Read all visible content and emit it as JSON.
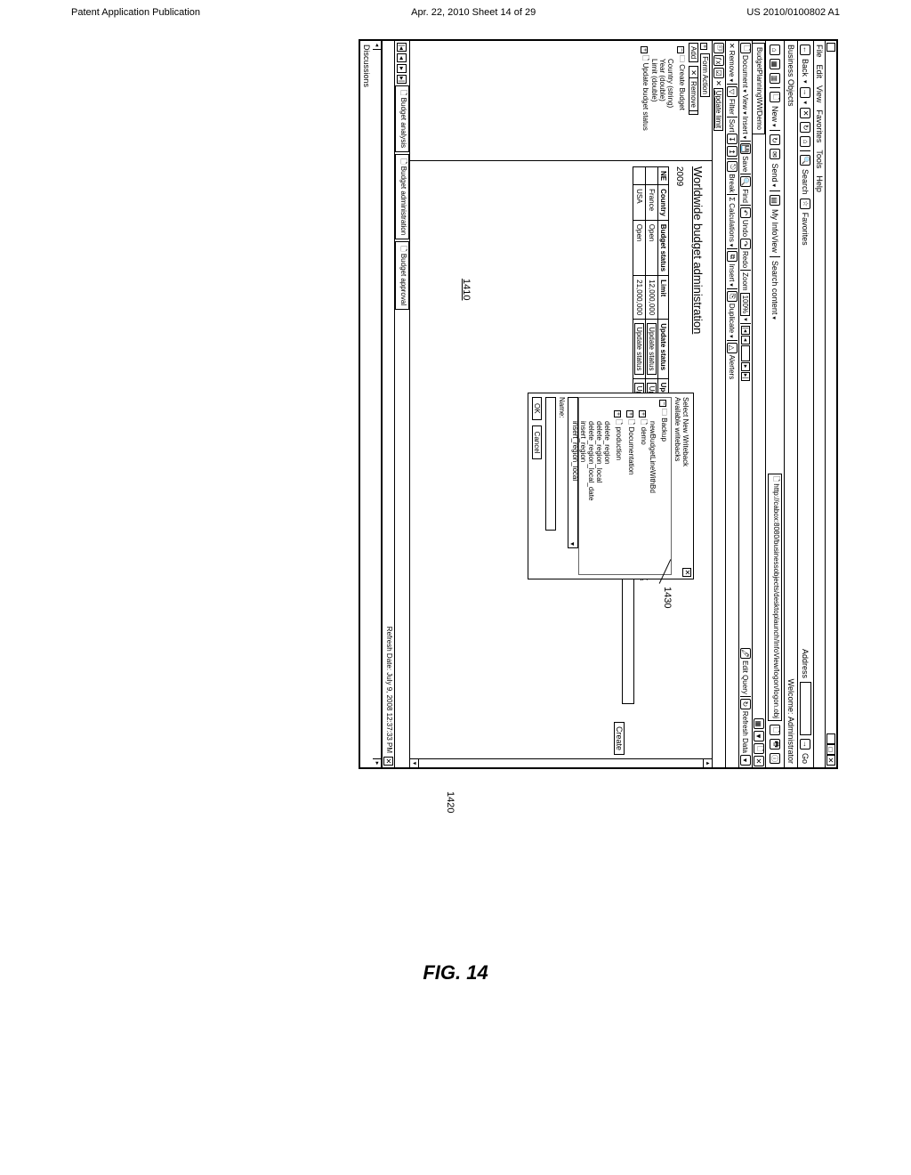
{
  "page_header": {
    "left": "Patent Application Publication",
    "center": "Apr. 22, 2010  Sheet 14 of 29",
    "right": "US 2010/0100802 A1"
  },
  "figure_label": "FIG. 14",
  "callouts": {
    "c1410": "1410",
    "c1420": "1420",
    "c1430": "1430"
  },
  "window": {
    "menus": [
      "File",
      "Edit",
      "View",
      "Favorites",
      "Tools",
      "Help"
    ],
    "back": "Back",
    "search": "Search",
    "favorites": "Favorites",
    "address_label": "Address",
    "go": "Go"
  },
  "portal": {
    "brand": "Business Objects",
    "welcome": "Welcome:",
    "user": "Administrator",
    "new": "New",
    "send": "Send",
    "myinfoview": "My InfoView",
    "search_content": "Search content",
    "url": "http://cabox:8080/businessobjects/desktoplaunch/InfoView/logon/logon.obj"
  },
  "doc": {
    "tab": "BudgetPlanningWWDemo",
    "document": "Document",
    "view": "View",
    "insert": "Insert",
    "save": "Save",
    "find": "Find",
    "undo": "Undo",
    "redo": "Redo",
    "zoom": "Zoom",
    "zoom_value": "100%",
    "edit_query": "Edit Query",
    "refresh_data": "Refresh Data",
    "remove": "Remove",
    "filter": "Filter",
    "sort": "Sort",
    "break": "Break",
    "calculations": "Calculations",
    "insert2": "Insert",
    "duplicate": "Duplicate",
    "alerters": "Alerters",
    "update_limit": "Update limit"
  },
  "form_panel": {
    "title": "Form Action",
    "add": "Add",
    "remove": "Remove",
    "root": "Create Budget",
    "items": [
      "Country (string)",
      "Year (double)",
      "Limit (double)",
      "Update budget status"
    ]
  },
  "report": {
    "title": "Worldwide budget administration",
    "year": "2009",
    "columns": [
      "NE",
      "Country",
      "Budget status",
      "Limit"
    ],
    "rows": [
      {
        "country": "France",
        "status": "Open",
        "limit": "12,000,000",
        "p": "Update status",
        "q": "Update Limit"
      },
      {
        "country": "USA",
        "status": "Open",
        "limit": "21,000,000",
        "p": "Update status",
        "q": "Update Limit"
      }
    ],
    "limit_label": "Limit",
    "create": "Create"
  },
  "dialog": {
    "title": "Select New Writeback",
    "subtitle": "Available writebacks",
    "tree": {
      "backup": "Backup",
      "new_line": "newBudgetLineWithBd",
      "demo": "demo",
      "documentation": "Documentation",
      "production": "production",
      "items": [
        "delete_region",
        "delete_region_local",
        "delete_region_local_date",
        "insert_region",
        "insert_region_local"
      ]
    },
    "name": "Name:",
    "ok": "OK",
    "cancel": "Cancel"
  },
  "bottom_tabs": [
    "Budget analysis",
    "Budget administration",
    "Budget approval"
  ],
  "status": {
    "refresh_date": "Refresh Date: July 9, 2008  12:37:33 PM"
  },
  "discussions": "Discussions"
}
